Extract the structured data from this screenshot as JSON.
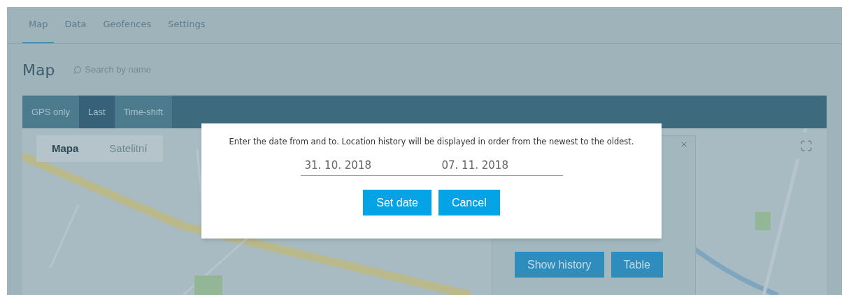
{
  "tabs": [
    {
      "label": "Map",
      "selected": true
    },
    {
      "label": "Data",
      "selected": false
    },
    {
      "label": "Geofences",
      "selected": false
    },
    {
      "label": "Settings",
      "selected": false
    }
  ],
  "page_title": "Map",
  "search": {
    "placeholder": "Search by name"
  },
  "mode_buttons": [
    {
      "label": "GPS only",
      "selected": false
    },
    {
      "label": "Last",
      "selected": true
    },
    {
      "label": "Time-shift",
      "selected": false
    }
  ],
  "map": {
    "type_buttons": [
      {
        "label": "Mapa",
        "selected": true
      },
      {
        "label": "Satelitní",
        "selected": false
      }
    ]
  },
  "info_popup": {
    "buttons": [
      "Show history",
      "Table"
    ]
  },
  "dialog": {
    "message": "Enter the date from and to. Location history will be displayed in order from the newest to the oldest.",
    "date_from": "31. 10. 2018",
    "date_to": "07. 11. 2018",
    "buttons": [
      "Set date",
      "Cancel"
    ]
  }
}
